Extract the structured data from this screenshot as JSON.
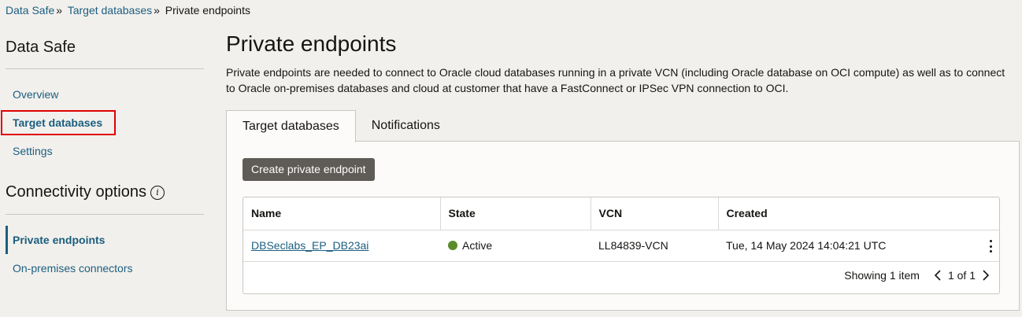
{
  "breadcrumb": {
    "items": [
      "Data Safe",
      "Target databases",
      "Private endpoints"
    ],
    "separator": "»"
  },
  "sidebar": {
    "title": "Data Safe",
    "items": [
      {
        "label": "Overview"
      },
      {
        "label": "Target databases"
      },
      {
        "label": "Settings"
      }
    ],
    "section_title": "Connectivity options",
    "section_icon": "info-icon",
    "section_items": [
      {
        "label": "Private endpoints"
      },
      {
        "label": "On-premises connectors"
      }
    ]
  },
  "main": {
    "title": "Private endpoints",
    "description": "Private endpoints are needed to connect to Oracle cloud databases running in a private VCN (including Oracle database on OCI compute) as well as to connect to Oracle on-premises databases and cloud at customer that have a FastConnect or IPSec VPN connection to OCI.",
    "tabs": [
      {
        "label": "Target databases"
      },
      {
        "label": "Notifications"
      }
    ],
    "create_button": "Create private endpoint",
    "table": {
      "columns": [
        "Name",
        "State",
        "VCN",
        "Created"
      ],
      "rows": [
        {
          "name": "DBSeclabs_EP_DB23ai",
          "state": "Active",
          "vcn": "LL84839-VCN",
          "created": "Tue, 14 May 2024 14:04:21 UTC"
        }
      ]
    },
    "pager": {
      "showing": "Showing 1 item",
      "pages": "1 of 1"
    }
  },
  "colors": {
    "link": "#1b5e7f",
    "highlight": "#e00000",
    "active_state": "#5b8c2a",
    "button": "#5f5b57"
  }
}
